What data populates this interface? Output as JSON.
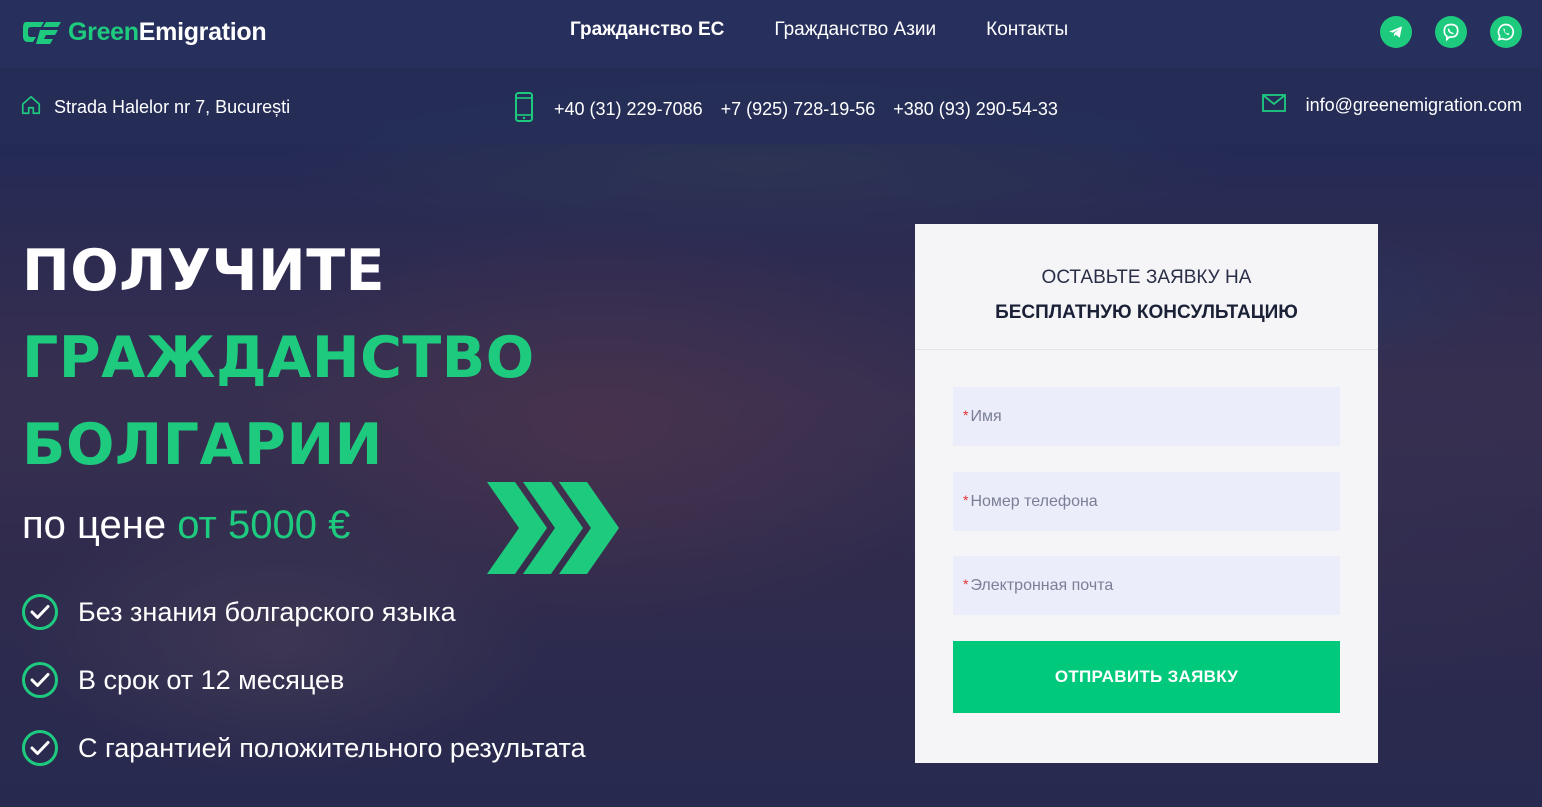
{
  "brand": {
    "name_part1": "Green",
    "name_part2": "Emigration",
    "accent_color": "#1ecb7e"
  },
  "nav": {
    "items": [
      {
        "label": "Гражданство ЕС"
      },
      {
        "label": "Гражданство Азии"
      },
      {
        "label": "Контакты"
      }
    ]
  },
  "social": [
    {
      "icon": "telegram-icon"
    },
    {
      "icon": "viber-icon"
    },
    {
      "icon": "whatsapp-icon"
    }
  ],
  "contacts": {
    "address": "Strada Halelor nr 7, București",
    "phones": [
      "+40 (31) 229-7086",
      "+7 (925) 728-19-56",
      "+380 (93) 290-54-33"
    ],
    "email": "info@greenemigration.com"
  },
  "hero": {
    "line1": "ПОЛУЧИТЕ",
    "line2": "ГРАЖДАНСТВО",
    "line3": "БОЛГАРИИ",
    "price_prefix": "по цене",
    "price_value": "от 5000 €",
    "bullets": [
      "Без знания болгарского языка",
      "В срок от 12 месяцев",
      "С гарантией положительного результата"
    ]
  },
  "form": {
    "title_line1": "ОСТАВЬТЕ ЗАЯВКУ НА",
    "title_line2": "БЕСПЛАТНУЮ КОНСУЛЬТАЦИЮ",
    "required_mark": "*",
    "name_placeholder": "Имя",
    "phone_placeholder": "Номер телефона",
    "email_placeholder": "Электронная почта",
    "submit_label": "ОТПРАВИТЬ ЗАЯВКУ"
  }
}
